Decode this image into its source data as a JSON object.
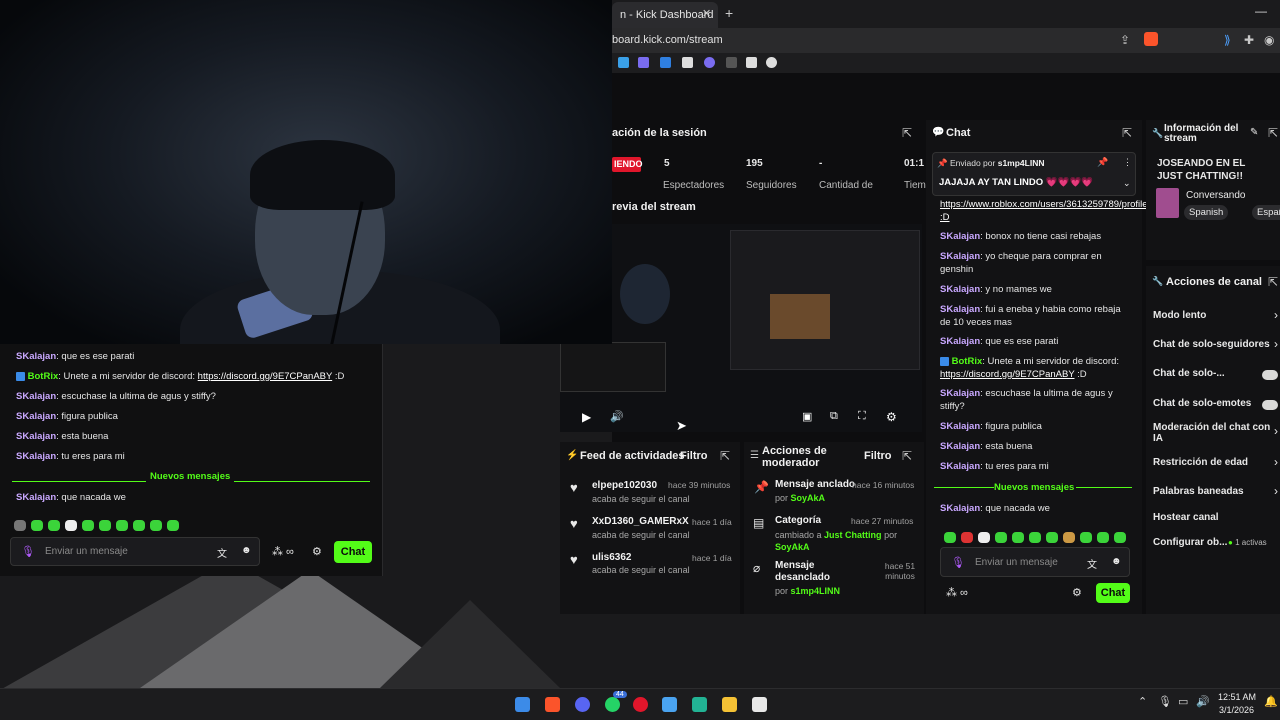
{
  "browser": {
    "tab_title": "n - Kick Dashboard",
    "url": "board.kick.com/stream"
  },
  "session": {
    "title": "ación de la sesión",
    "live_badge": "IENDO",
    "stats": [
      {
        "value": "5",
        "label": "Espectadores"
      },
      {
        "value": "195",
        "label": "Seguidores"
      },
      {
        "value": "-",
        "label": "Cantidad de"
      },
      {
        "value": "01:1",
        "label": "Tiem"
      }
    ]
  },
  "preview": {
    "title": "revia del stream"
  },
  "chat": {
    "title": "Chat",
    "pinned": {
      "sent_by": "Enviado por",
      "user": "s1mp4LINN",
      "message": "JAJAJA AY TAN LINDO 💗💗💗💗"
    },
    "messages": [
      {
        "user": "",
        "text": "https://www.roblox.com/users/3613259789/profile :D",
        "link": true
      },
      {
        "user": "SKalajan",
        "text": "bonox no tiene casi rebajas"
      },
      {
        "user": "SKalajan",
        "text": "yo cheque para comprar en genshin"
      },
      {
        "user": "SKalajan",
        "text": "y no mames we"
      },
      {
        "user": "SKalajan",
        "text": "fui a eneba y habia como rebaja de 10 veces mas"
      },
      {
        "user": "SKalajan",
        "text": "que es ese parati"
      },
      {
        "user": "BotRix",
        "text": "Unete a mi servidor de discord:",
        "link_text": "https://discord.gg/9E7CPanABY",
        "suffix": ":D"
      },
      {
        "user": "SKalajan",
        "text": "escuchase la ultima de agus y stiffy?"
      },
      {
        "user": "SKalajan",
        "text": "figura publica"
      },
      {
        "user": "SKalajan",
        "text": "esta buena"
      },
      {
        "user": "SKalajan",
        "text": "tu eres para mi"
      }
    ],
    "new_messages_label": "Nuevos mensajes",
    "after_new": {
      "user": "SKalajan",
      "text": "que nacada we"
    },
    "input_placeholder": "Enviar un mensaje",
    "send_label": "Chat"
  },
  "stream_info": {
    "title": "Información del stream",
    "stream_title": "JOSEANDO EN EL JUST CHATTING!!",
    "category": "Conversando",
    "tags": [
      "Spanish",
      "Español"
    ]
  },
  "channel_actions": {
    "title": "Acciones de canal",
    "items": [
      {
        "label": "Modo lento",
        "control": "arrow"
      },
      {
        "label": "Chat de solo-seguidores",
        "control": "arrow"
      },
      {
        "label": "Chat de solo-...",
        "control": "toggle"
      },
      {
        "label": "Chat de solo-emotes",
        "control": "toggle"
      },
      {
        "label": "Moderación del chat con IA",
        "control": "arrow"
      },
      {
        "label": "Restricción de edad",
        "control": "arrow"
      },
      {
        "label": "Palabras baneadas",
        "control": "arrow"
      },
      {
        "label": "Hostear canal",
        "control": "none"
      },
      {
        "label": "Configurar ob...",
        "control": "badge",
        "badge": "1 activas"
      }
    ]
  },
  "activity_feed": {
    "title": "Feed de actividades",
    "filter": "Filtro",
    "items": [
      {
        "name": "elpepe102030",
        "action": "acaba de seguir el canal",
        "time": "hace 39 minutos"
      },
      {
        "name": "XxD1360_GAMERxX",
        "action": "acaba de seguir el canal",
        "time": "hace 1 día"
      },
      {
        "name": "ulis6362",
        "action": "acaba de seguir el canal",
        "time": "hace 1 día"
      }
    ]
  },
  "mod_actions": {
    "title": "Acciones de moderador",
    "filter": "Filtro",
    "items": [
      {
        "title": "Mensaje anclado",
        "detail_prefix": "por",
        "detail_user": "SoyAkA",
        "time": "hace 16 minutos"
      },
      {
        "title": "Categoría",
        "detail_prefix": "cambiado a",
        "detail_cat": "Just Chatting",
        "detail_mid": "por",
        "detail_user": "SoyAkA",
        "time": "hace 27 minutos"
      },
      {
        "title": "Mensaje desanclado",
        "detail_prefix": "por",
        "detail_user": "s1mp4LINN",
        "time": "hace 51 minutos"
      }
    ]
  },
  "overlay_chat": {
    "messages": [
      {
        "user": "SKalajan",
        "text": "que es ese parati"
      },
      {
        "user": "BotRix",
        "text": "Unete a mi servidor de discord:",
        "link_text": "https://discord.gg/9E7CPanABY",
        "suffix": ":D"
      },
      {
        "user": "SKalajan",
        "text": "escuchase la ultima de agus y stiffy?"
      },
      {
        "user": "SKalajan",
        "text": "figura publica"
      },
      {
        "user": "SKalajan",
        "text": "esta buena"
      },
      {
        "user": "SKalajan",
        "text": "tu eres para mi"
      }
    ],
    "new_messages_label": "Nuevos mensajes",
    "after_new": {
      "user": "SKalajan",
      "text": "que nacada we"
    },
    "input_placeholder": "Enviar un mensaje",
    "send_label": "Chat"
  },
  "taskbar": {
    "time": "12:51 AM",
    "date": "3/1/2026",
    "whatsapp_badge": "44"
  },
  "colors": {
    "kick_green": "#53fc18",
    "username": "#c9a8ff",
    "live_red": "#e0162b"
  }
}
